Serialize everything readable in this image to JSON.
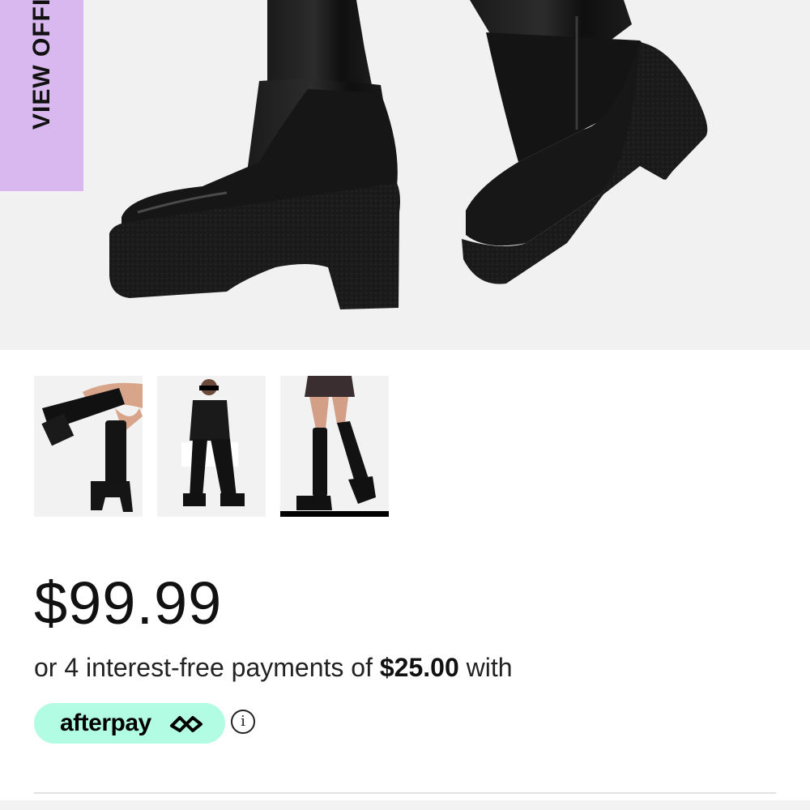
{
  "hero": {
    "image_alt": "Black platform knee-high boots",
    "offer_tab_label": "VIEW OFFI"
  },
  "thumbnails": [
    {
      "alt": "Boots side view"
    },
    {
      "alt": "Model seated wearing boots"
    },
    {
      "alt": "Model standing wearing boots"
    }
  ],
  "selected_thumbnail_index": 2,
  "pricing": {
    "price": "$99.99",
    "installments_prefix": "or 4 interest-free payments of ",
    "installment_amount": "$25.00",
    "installments_suffix": " with"
  },
  "afterpay": {
    "label": "afterpay",
    "badge_color": "#b2fce4",
    "info_glyph": "i"
  },
  "colors": {
    "offer_tab": "#d9b8f0",
    "hero_background": "#f1f1f1"
  }
}
